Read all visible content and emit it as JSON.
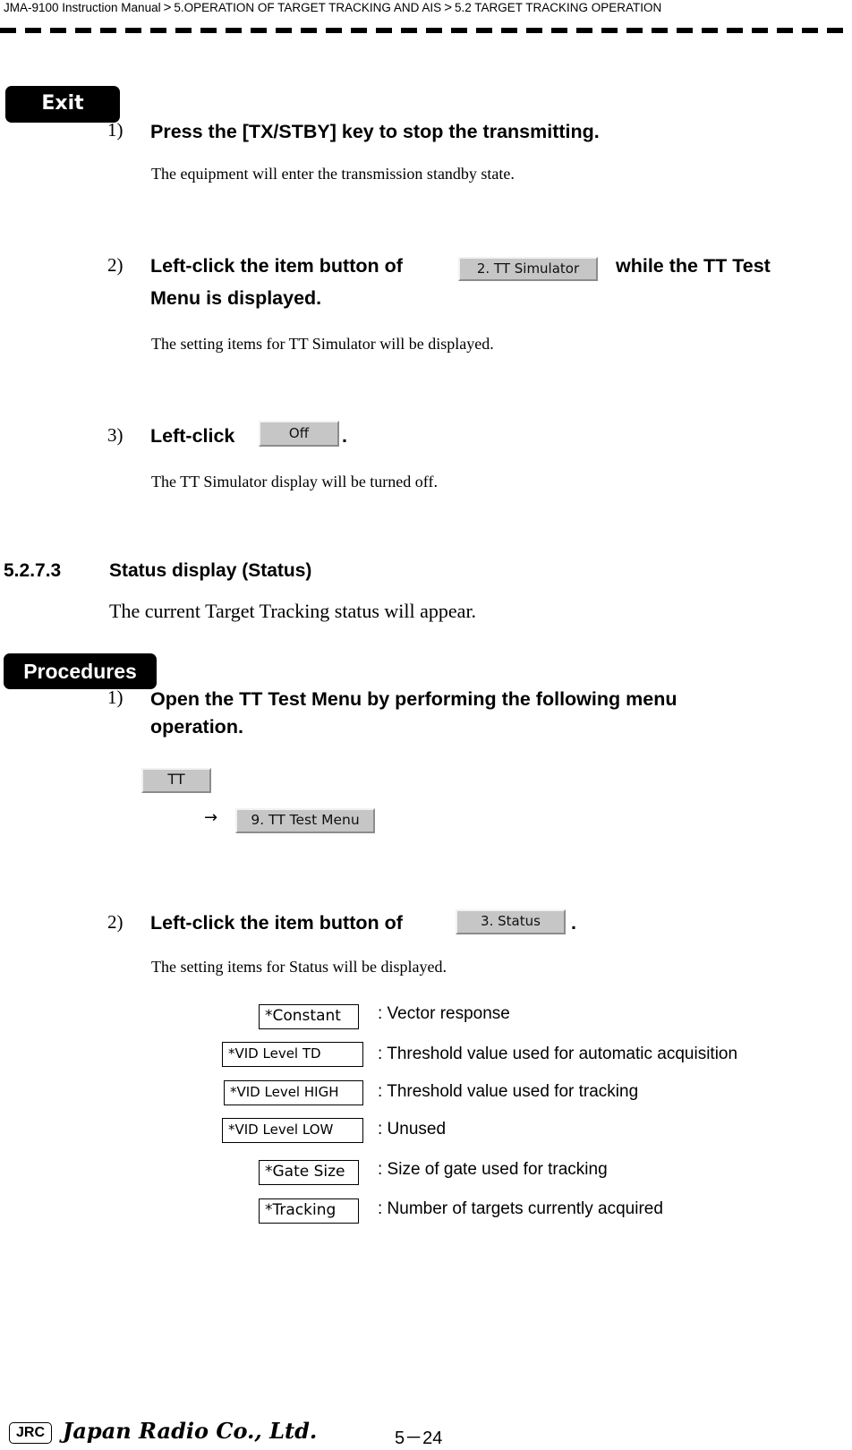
{
  "header": {
    "breadcrumb": [
      "JMA-9100 Instruction Manual",
      "5.OPERATION OF TARGET TRACKING AND AIS",
      "5.2  TARGET TRACKING OPERATION"
    ],
    "separator": ">"
  },
  "exit_section": {
    "tag": "Exit",
    "steps": [
      {
        "number": "1)",
        "instruction": "Press the [TX/STBY] key to stop the transmitting.",
        "result": "The equipment will enter the transmission standby state."
      },
      {
        "number": "2)",
        "instruction_before": "Left-click the item button of",
        "button": "2. TT Simulator",
        "instruction_after": "while the TT Test",
        "instruction_line2": "Menu is displayed.",
        "result": "The setting items for TT Simulator will be displayed."
      },
      {
        "number": "3)",
        "instruction_before": "Left-click",
        "button": "Off",
        "instruction_after": ".",
        "result": "The TT Simulator display will be turned off."
      }
    ]
  },
  "section": {
    "number": "5.2.7.3",
    "title": "Status display (Status)",
    "lead": "The current Target Tracking status will appear."
  },
  "procedures": {
    "tag": "Procedures",
    "steps": [
      {
        "number": "1)",
        "instruction_line1": "Open the TT Test Menu by performing the following menu",
        "instruction_line2": "operation.",
        "menu_path": [
          "TT",
          "9. TT Test Menu"
        ],
        "arrow": "→"
      },
      {
        "number": "2)",
        "instruction_before": "Left-click the item button of",
        "button": "3. Status",
        "instruction_after": ".",
        "result": "The setting items for Status will be displayed."
      }
    ],
    "status_items": [
      {
        "label": "*Constant",
        "description": ": Vector response"
      },
      {
        "label": "*VID Level TD",
        "description": ": Threshold value used for automatic acquisition"
      },
      {
        "label": "*VID Level HIGH",
        "description": ": Threshold value used for tracking"
      },
      {
        "label": "*VID Level LOW",
        "description": ": Unused"
      },
      {
        "label": "*Gate Size",
        "description": ": Size of gate used for tracking"
      },
      {
        "label": "*Tracking",
        "description": ": Number of targets currently acquired"
      }
    ]
  },
  "footer": {
    "logo_mark": "JRC",
    "company": "Japan Radio Co., Ltd.",
    "page": "5－24"
  }
}
